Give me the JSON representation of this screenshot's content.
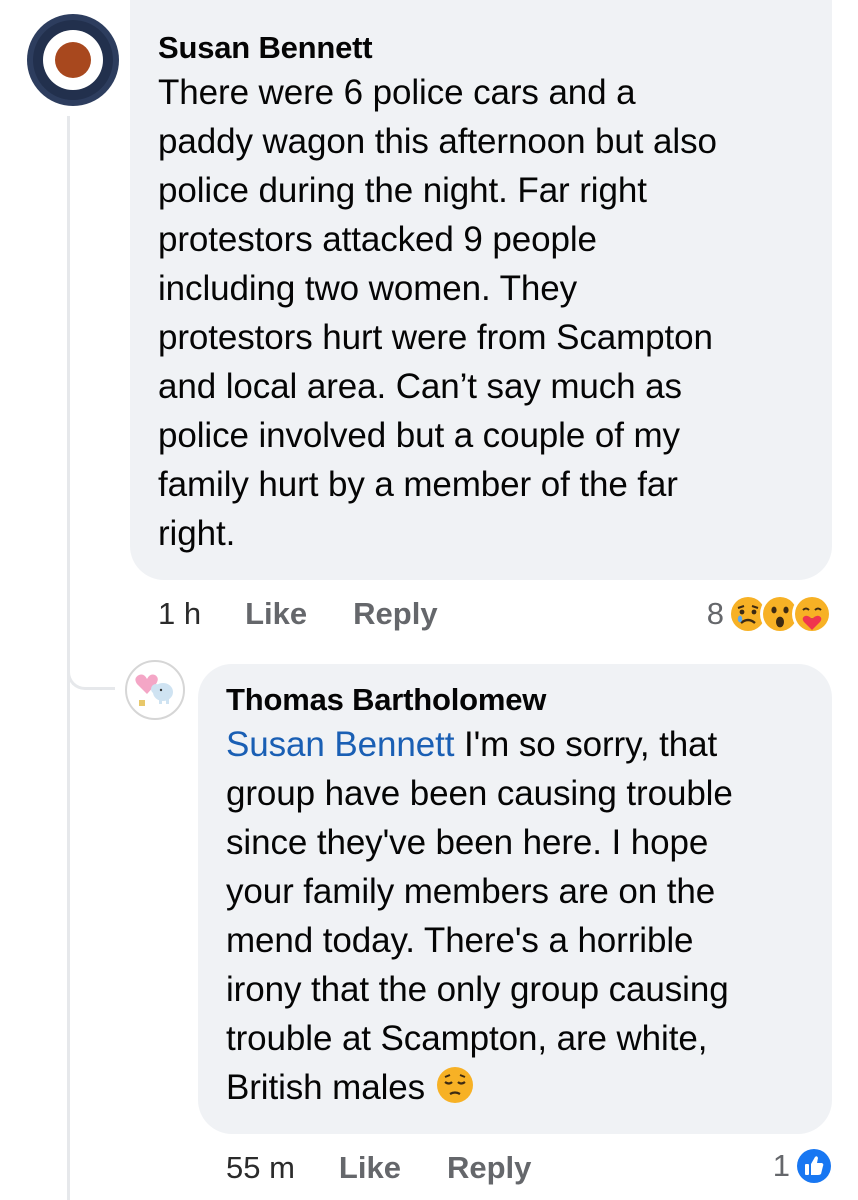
{
  "comment": {
    "author": "Susan Bennett",
    "text_lines": [
      "There were 6 police cars and a",
      "paddy wagon this afternoon but also",
      "police during the night.  Far right",
      "protestors attacked 9 people",
      "including two women. They",
      "protestors hurt were from Scampton",
      "and local area.  Can’t say much as",
      "police involved but a couple of my",
      "family hurt by a member of the far",
      "right."
    ],
    "time": "1 h",
    "like_label": "Like",
    "reply_label": "Reply",
    "reaction_count": "8",
    "reaction_icons": [
      "sad-face-icon",
      "wow-face-icon",
      "care-face-icon"
    ],
    "avatar_icon": "roundel-avatar-icon"
  },
  "reply": {
    "author": "Thomas Bartholomew",
    "mention": "Susan Bennett",
    "text_lines": [
      " I'm so sorry, that",
      "group have been causing trouble",
      "since they've been here. I hope",
      "your family members are on the",
      "mend today. There's a horrible",
      "irony that the only group causing",
      "trouble at Scampton, are white,",
      "British males "
    ],
    "trailing_emoji": "pensive-face-icon",
    "time": "55 m",
    "like_label": "Like",
    "reply_label": "Reply",
    "reaction_count": "1",
    "reaction_icons": [
      "like-thumb-icon"
    ],
    "avatar_icon": "heart-elephant-avatar-icon"
  },
  "colors": {
    "bubble": "#f0f2f5",
    "meta_text": "#65676b",
    "mention": "#1a5fb4",
    "like_blue": "#1877f2",
    "reaction_yellow": "#f7b125"
  }
}
